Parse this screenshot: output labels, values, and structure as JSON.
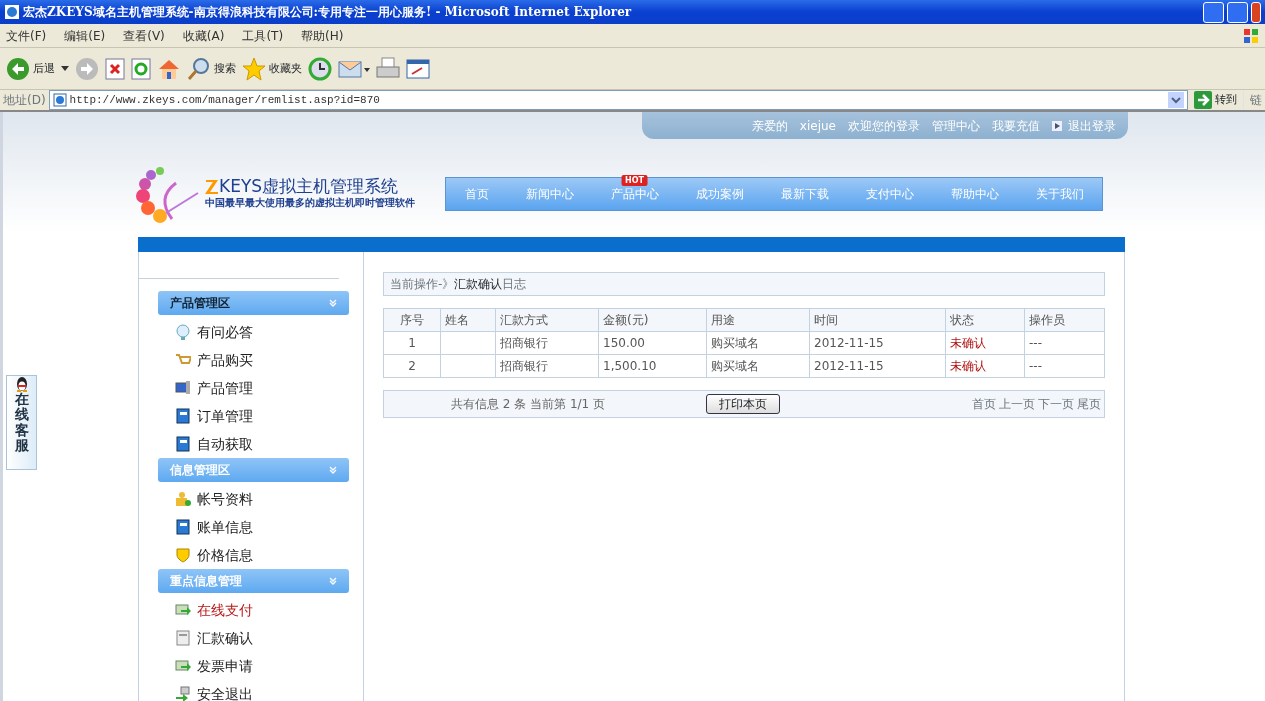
{
  "window": {
    "title": "宏杰ZKEYS域名主机管理系统-南京得浪科技有限公司:专用专注一用心服务! - Microsoft Internet Explorer"
  },
  "menu": [
    "文件(F)",
    "编辑(E)",
    "查看(V)",
    "收藏(A)",
    "工具(T)",
    "帮助(H)"
  ],
  "toolbar": {
    "back": "后退",
    "search": "搜索",
    "favorites": "收藏夹"
  },
  "address_bar": {
    "label": "地址(D)",
    "url": "http://www.zkeys.com/manager/remlist.asp?id=870",
    "go": "转到",
    "links": "链"
  },
  "user_bar": {
    "greeting": "亲爱的",
    "username": "xiejue",
    "welcome": "欢迎您的登录",
    "links": [
      "管理中心",
      "我要充值"
    ],
    "logout": "退出登录"
  },
  "logo": {
    "title": "KEYS虚拟主机管理系统",
    "subtitle": "中国最早最大使用最多的虚拟主机即时管理软件"
  },
  "nav": [
    {
      "label": "首页"
    },
    {
      "label": "新闻中心"
    },
    {
      "label": "产品中心",
      "badge": "HOT"
    },
    {
      "label": "成功案例"
    },
    {
      "label": "最新下载"
    },
    {
      "label": "支付中心"
    },
    {
      "label": "帮助中心"
    },
    {
      "label": "关于我们"
    }
  ],
  "sidebar": [
    {
      "title": "产品管理区",
      "items": [
        {
          "label": "有问必答",
          "emphasized": false
        },
        {
          "label": "产品购买",
          "emphasized": false
        },
        {
          "label": "产品管理",
          "emphasized": false
        },
        {
          "label": "订单管理",
          "emphasized": false
        },
        {
          "label": "自动获取",
          "emphasized": false
        }
      ]
    },
    {
      "title": "信息管理区",
      "items": [
        {
          "label": "帐号资料",
          "emphasized": false
        },
        {
          "label": "账单信息",
          "emphasized": false
        },
        {
          "label": "价格信息",
          "emphasized": false
        }
      ]
    },
    {
      "title": "重点信息管理",
      "items": [
        {
          "label": "在线支付",
          "emphasized": true
        },
        {
          "label": "汇款确认",
          "emphasized": false
        },
        {
          "label": "发票申请",
          "emphasized": false
        },
        {
          "label": "安全退出",
          "emphasized": false
        }
      ]
    }
  ],
  "breadcrumb": {
    "prefix": "当前操作-》",
    "current": "汇款确认",
    "suffix": "日志"
  },
  "table": {
    "columns": [
      "序号",
      "姓名",
      "汇款方式",
      "金额(元)",
      "用途",
      "时间",
      "状态",
      "操作员"
    ],
    "rows": [
      [
        "1",
        "",
        "招商银行",
        "150.00",
        "购买域名",
        "2012-11-15",
        "未确认",
        "---"
      ],
      [
        "2",
        "",
        "招商银行",
        "1,500.10",
        "购买域名",
        "2012-11-15",
        "未确认",
        "---"
      ]
    ]
  },
  "pager": {
    "info": "共有信息 2 条 当前第 1/1 页",
    "print": "打印本页",
    "links": [
      "首页",
      "上一页",
      "下一页",
      "尾页"
    ]
  },
  "chat_tab": {
    "label": "在线客服"
  }
}
